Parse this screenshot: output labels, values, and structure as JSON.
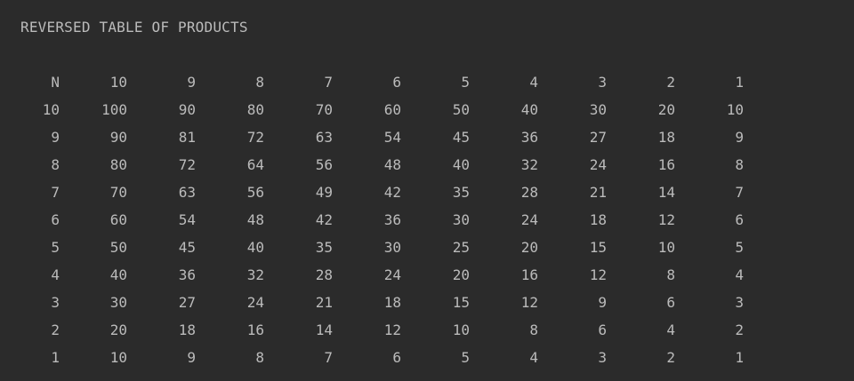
{
  "console": {
    "title": "REVERSED TABLE OF PRODUCTS",
    "rows": [
      [
        "N",
        "10",
        "9",
        "8",
        "7",
        "6",
        "5",
        "4",
        "3",
        "2",
        "1"
      ],
      [
        "10",
        "100",
        "90",
        "80",
        "70",
        "60",
        "50",
        "40",
        "30",
        "20",
        "10"
      ],
      [
        "9",
        "90",
        "81",
        "72",
        "63",
        "54",
        "45",
        "36",
        "27",
        "18",
        "9"
      ],
      [
        "8",
        "80",
        "72",
        "64",
        "56",
        "48",
        "40",
        "32",
        "24",
        "16",
        "8"
      ],
      [
        "7",
        "70",
        "63",
        "56",
        "49",
        "42",
        "35",
        "28",
        "21",
        "14",
        "7"
      ],
      [
        "6",
        "60",
        "54",
        "48",
        "42",
        "36",
        "30",
        "24",
        "18",
        "12",
        "6"
      ],
      [
        "5",
        "50",
        "45",
        "40",
        "35",
        "30",
        "25",
        "20",
        "15",
        "10",
        "5"
      ],
      [
        "4",
        "40",
        "36",
        "32",
        "28",
        "24",
        "20",
        "16",
        "12",
        "8",
        "4"
      ],
      [
        "3",
        "30",
        "27",
        "24",
        "21",
        "18",
        "15",
        "12",
        "9",
        "6",
        "3"
      ],
      [
        "2",
        "20",
        "18",
        "16",
        "14",
        "12",
        "10",
        "8",
        "6",
        "4",
        "2"
      ],
      [
        "1",
        "10",
        "9",
        "8",
        "7",
        "6",
        "5",
        "4",
        "3",
        "2",
        "1"
      ]
    ]
  },
  "colors": {
    "background": "#2b2b2b",
    "text": "#bbbbbb"
  }
}
